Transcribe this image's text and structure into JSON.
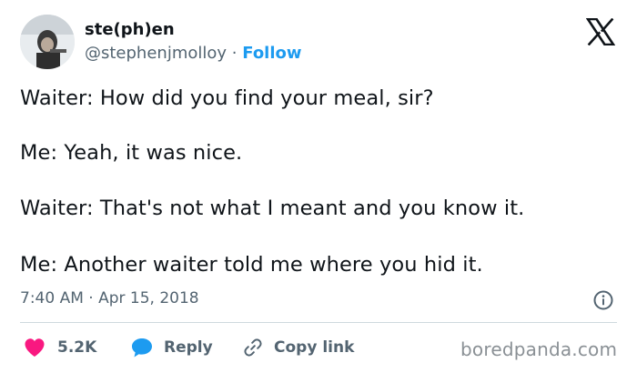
{
  "author": {
    "display_name": "ste(ph)en",
    "handle": "@stephenjmolloy",
    "separator": "·",
    "follow_label": "Follow"
  },
  "tweet": {
    "lines": [
      "Waiter: How did you find your meal, sir?",
      "Me: Yeah, it was nice.",
      "Waiter: That's not what I meant and you know it.",
      "Me: Another waiter told me where you hid it."
    ],
    "timestamp": "7:40 AM · Apr 15, 2018"
  },
  "actions": {
    "like_count": "5.2K",
    "reply_label": "Reply",
    "copy_link_label": "Copy link"
  },
  "watermark": "boredpanda.com",
  "icons": {
    "brand": "x-logo-icon",
    "like": "heart-icon",
    "reply": "speech-bubble-icon",
    "copy": "link-icon",
    "info": "info-icon"
  },
  "colors": {
    "text": "#0f1419",
    "muted": "#536471",
    "link_blue": "#1d9bf0",
    "heart_pink": "#f91880",
    "divider": "#cfd9de",
    "watermark": "#8a9095"
  }
}
